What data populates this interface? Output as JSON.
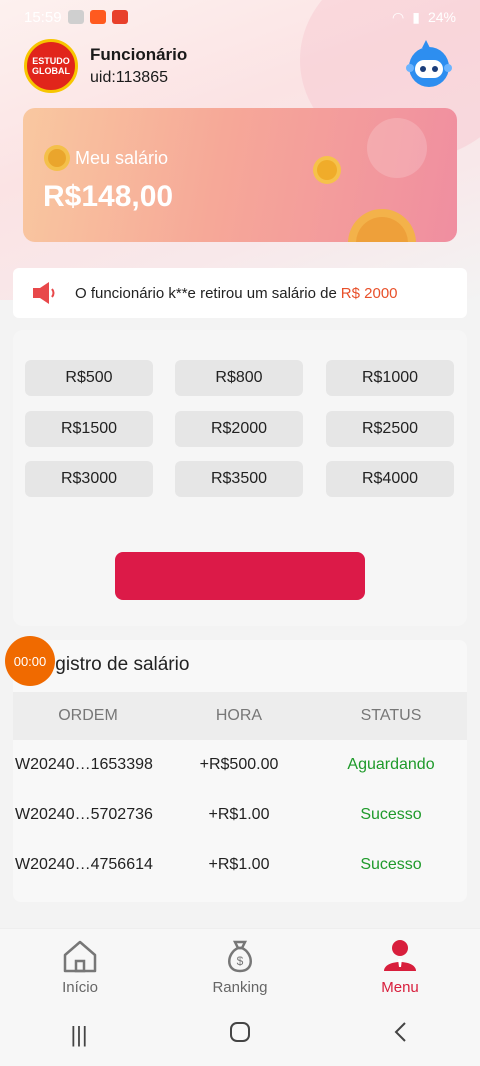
{
  "status_bar": {
    "time": "15:59",
    "battery": "24%"
  },
  "header": {
    "logo_line1": "ESTUDO",
    "logo_line2": "GLOBAL",
    "name": "Funcionário",
    "uid": "uid:113865"
  },
  "salary": {
    "label": "Meu salário",
    "amount": "R$148,00"
  },
  "notice": {
    "text": "O funcionário k**e retirou um salário de",
    "amount": "R$ 2000"
  },
  "amounts": [
    "R$500",
    "R$800",
    "R$1000",
    "R$1500",
    "R$2000",
    "R$2500",
    "R$3000",
    "R$3500",
    "R$4000"
  ],
  "records": {
    "title": "Registro de salário",
    "timer": "00:00",
    "columns": [
      "ORDEM",
      "HORA",
      "STATUS"
    ],
    "rows": [
      {
        "order": "W20240…1653398",
        "amount": "+R$500.00",
        "status": "Aguardando"
      },
      {
        "order": "W20240…5702736",
        "amount": "+R$1.00",
        "status": "Sucesso"
      },
      {
        "order": "W20240…4756614",
        "amount": "+R$1.00",
        "status": "Sucesso"
      }
    ]
  },
  "nav": {
    "home": "Início",
    "ranking": "Ranking",
    "menu": "Menu"
  },
  "colors": {
    "accent": "#dc1a48",
    "success": "#1e9a2a",
    "pending": "#1e9a2a",
    "notice_amount": "#e8502a"
  }
}
